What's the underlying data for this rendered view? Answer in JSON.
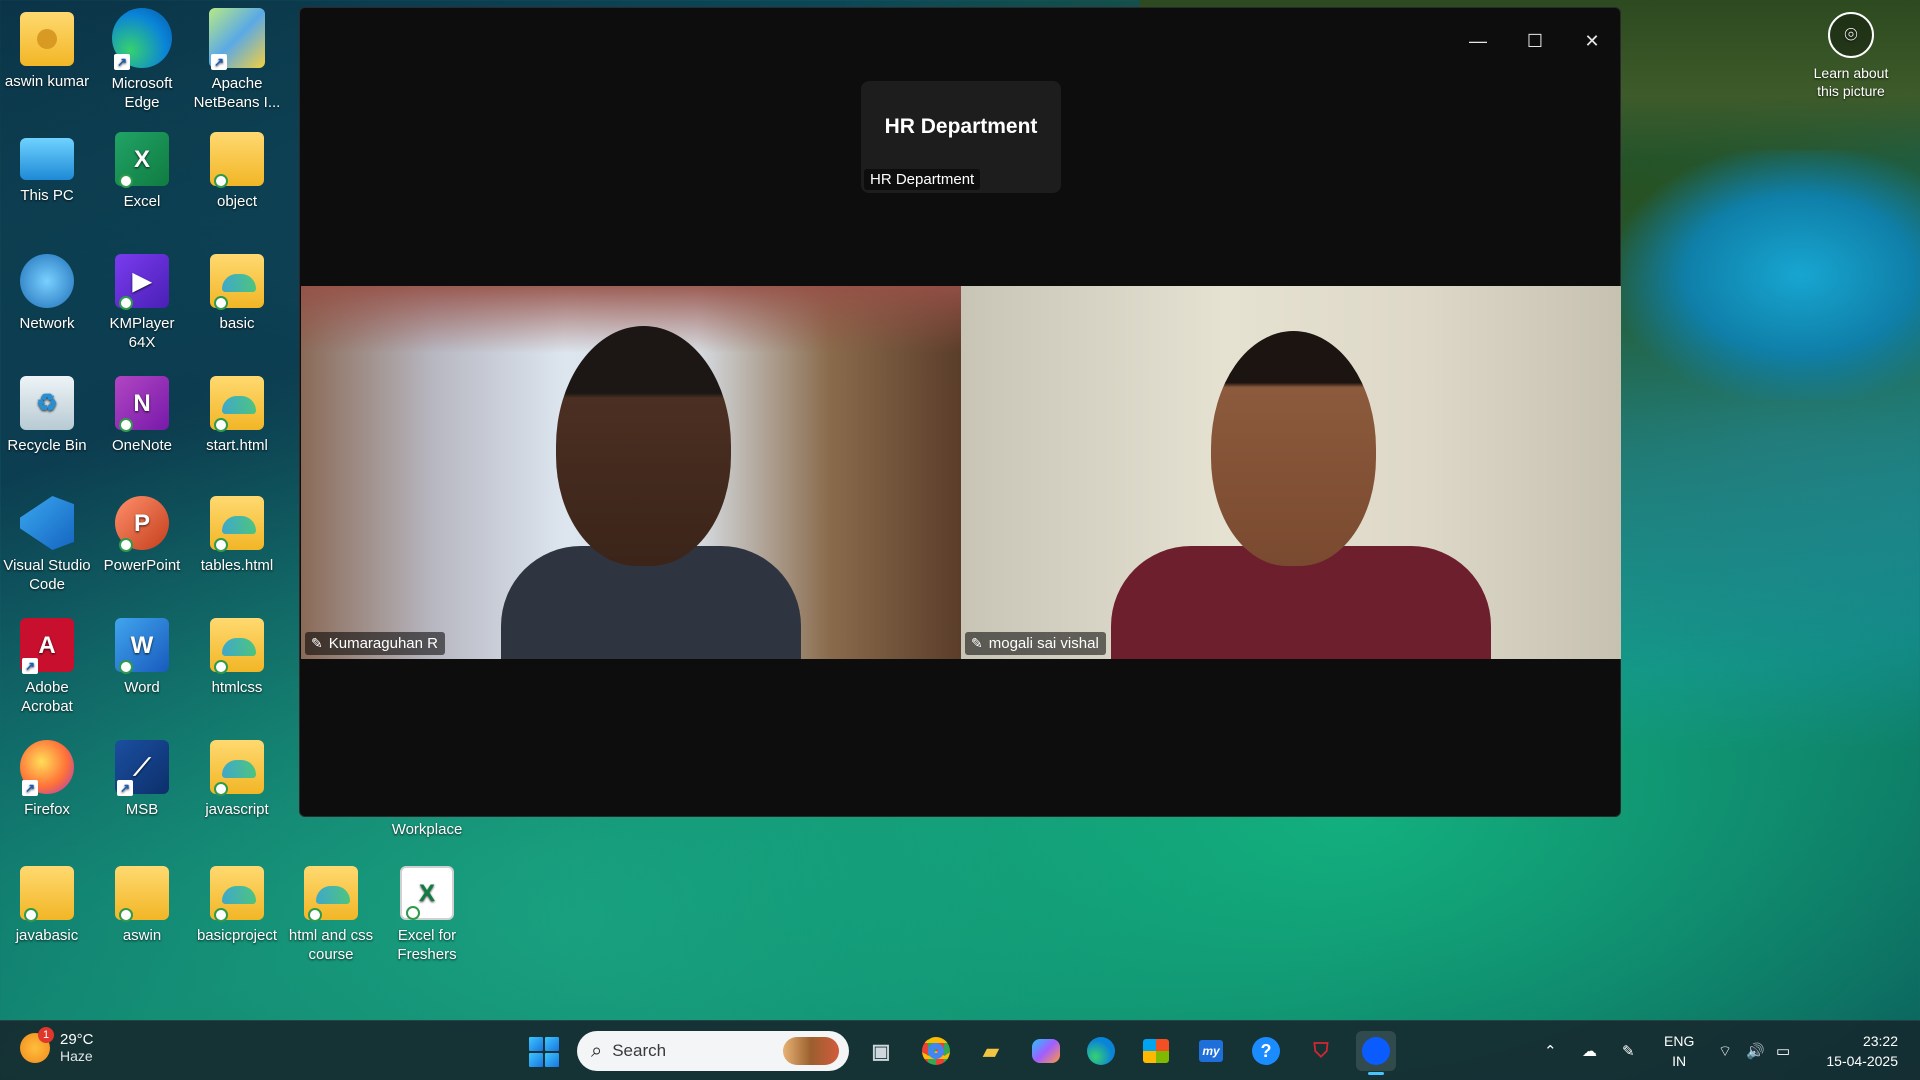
{
  "desktop": {
    "icons": [
      {
        "label": "aswin kumar"
      },
      {
        "label": "Microsoft Edge"
      },
      {
        "label": "Apache NetBeans I..."
      },
      {
        "label": "This PC"
      },
      {
        "label": "Excel"
      },
      {
        "label": "object"
      },
      {
        "label": "Network"
      },
      {
        "label": "KMPlayer 64X"
      },
      {
        "label": "basic"
      },
      {
        "label": "Recycle Bin"
      },
      {
        "label": "OneNote"
      },
      {
        "label": "start.html"
      },
      {
        "label": "Visual Studio Code"
      },
      {
        "label": "PowerPoint"
      },
      {
        "label": "tables.html"
      },
      {
        "label": "Adobe Acrobat"
      },
      {
        "label": "Word"
      },
      {
        "label": "htmlcss"
      },
      {
        "label": "Firefox"
      },
      {
        "label": "MSB"
      },
      {
        "label": "javascript"
      },
      {
        "label": "Workplace"
      },
      {
        "label": "javabasic"
      },
      {
        "label": "aswin"
      },
      {
        "label": "basicproject"
      },
      {
        "label": "html and css course"
      },
      {
        "label": "Excel for Freshers"
      }
    ],
    "learn_about": "Learn about this picture"
  },
  "zoom": {
    "hr_tile_title": "HR Department",
    "hr_tile_name": "HR Department",
    "participants": [
      {
        "name": "Kumaraguhan R"
      },
      {
        "name": "mogali sai vishal"
      }
    ]
  },
  "taskbar": {
    "weather_temp": "29°C",
    "weather_desc": "Haze",
    "weather_badge": "1",
    "search_placeholder": "Search",
    "lang_1": "ENG",
    "lang_2": "IN",
    "time": "23:22",
    "date": "15-04-2025"
  },
  "colors": {
    "zoom_bg": "#0d0d0d",
    "accent": "#4cc2ff"
  }
}
